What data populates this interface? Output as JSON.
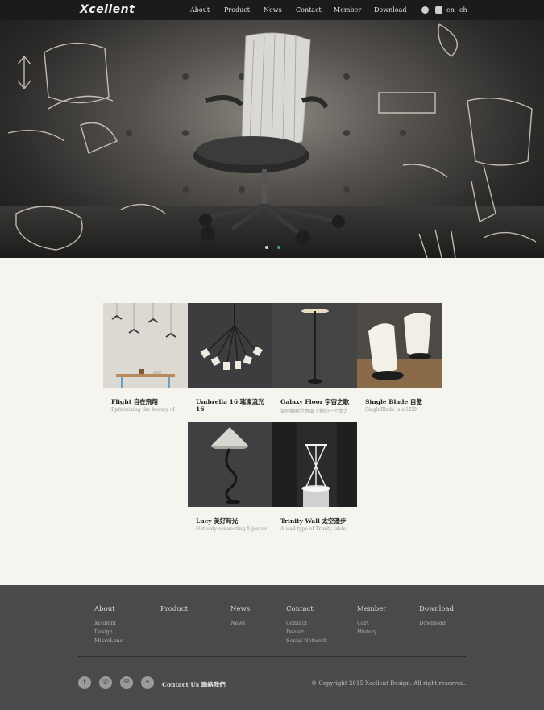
{
  "header": {
    "logo": "Xcellent",
    "nav": [
      "About",
      "Product",
      "News",
      "Contact",
      "Member",
      "Download"
    ],
    "utility_icons": [
      "user-icon",
      "cart-icon"
    ],
    "languages": [
      "en",
      "ch"
    ]
  },
  "hero": {
    "slider_dots": 2,
    "active_dot": 1
  },
  "products": [
    {
      "title": "Flight 自在飛翔",
      "desc": "Epitomizing the beauty of"
    },
    {
      "title": "Umbrella 16 璀璨流光 16",
      "desc": ""
    },
    {
      "title": "Galaxy Floor 宇宙之歌",
      "desc": "當阿姆斯壯跨出了他的一小步之"
    },
    {
      "title": "Single Blade 自傲",
      "desc": "SingleBlade is a LED"
    },
    {
      "title": "Lucy 美好時光",
      "desc": "Not only connecting 5 pieces"
    },
    {
      "title": "Trinity Wall 太空漫步",
      "desc": "A wall type of Trinity table."
    }
  ],
  "footer": {
    "columns": [
      {
        "heading": "About",
        "links": [
          "Xcellent",
          "Design",
          "MicroLens"
        ]
      },
      {
        "heading": "Product",
        "links": []
      },
      {
        "heading": "News",
        "links": [
          "News"
        ]
      },
      {
        "heading": "Contact",
        "links": [
          "Contact",
          "Dealer",
          "Social Network"
        ]
      },
      {
        "heading": "Member",
        "links": [
          "Cart",
          "History"
        ]
      },
      {
        "heading": "Download",
        "links": [
          "Download"
        ]
      }
    ],
    "social_icons": [
      "facebook-icon",
      "phone-icon",
      "mail-icon",
      "location-icon"
    ],
    "contact_us": "Contact Us 聯絡我們",
    "copyright": "© Copyright 2015 Xcellent Design. All right reserved."
  },
  "colors": {
    "header_bg": "#1b1b1b",
    "body_bg": "#f6f4ef",
    "footer_bg": "#4a494c",
    "dot_active": "#3aa39a"
  }
}
